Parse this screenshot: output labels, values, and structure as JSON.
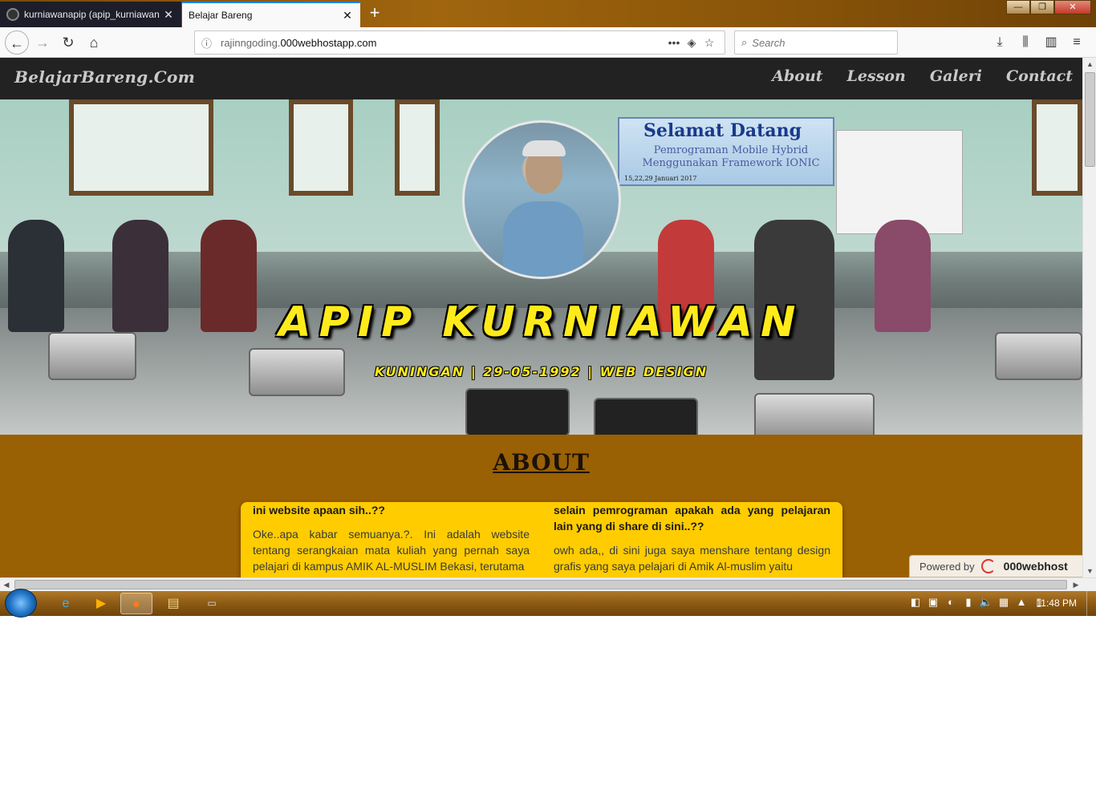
{
  "browser": {
    "tabs": [
      {
        "title": "kurniawanapip (apip_kurniawan",
        "active": false
      },
      {
        "title": "Belajar Bareng",
        "active": true
      }
    ],
    "new_tab_label": "+",
    "close_glyph": "✕",
    "url_dim": "rajinngoding.",
    "url_host": "000webhostapp.com",
    "search_placeholder": "Search",
    "window_controls": {
      "minimize": "—",
      "maximize": "❐",
      "close": "✕"
    }
  },
  "site": {
    "brand": "BelajarBareng.Com",
    "menu": [
      {
        "label": "About"
      },
      {
        "label": "Lesson"
      },
      {
        "label": "Galeri"
      },
      {
        "label": "Contact"
      }
    ],
    "hero": {
      "name": "APIP KURNIAWAN",
      "tagline": "KUNINGAN | 29-05-1992 | WEB DESIGN",
      "banner_title": "Selamat Datang",
      "banner_sub": "Pemrograman Mobile Hybrid Menggunakan Framework IONIC",
      "banner_date": "15,22,29 Januari 2017"
    },
    "about": {
      "title": "ABOUT",
      "left": {
        "heading": "ini website apaan sih..??",
        "body": "Oke..apa kabar semuanya.?. Ini adalah website tentang serangkaian mata kuliah yang pernah saya pelajari di kampus AMIK AL-MUSLIM Bekasi, terutama"
      },
      "right": {
        "heading": "selain pemrograman apakah ada yang pelajaran lain yang di share di sini..??",
        "body": "owh ada,, di sini juga saya menshare tentang design grafis yang saya pelajari di Amik Al-muslim yaitu"
      }
    },
    "powered": {
      "prefix": "Powered by",
      "name": "000webhost"
    }
  },
  "taskbar": {
    "clock": "11:48 PM"
  }
}
